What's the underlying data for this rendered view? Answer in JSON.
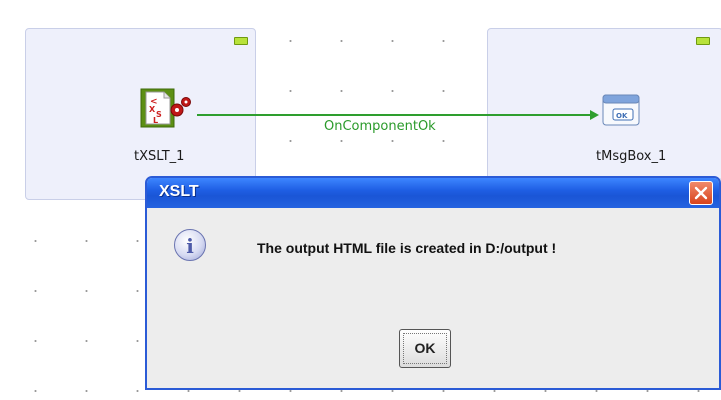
{
  "canvas": {
    "components": [
      {
        "label": "tXSLT_1",
        "icon": "xslt-icon"
      },
      {
        "label": "tMsgBox_1",
        "icon": "messagebox-icon"
      }
    ],
    "link": {
      "label": "OnComponentOk",
      "color": "#2e9e2e"
    }
  },
  "dialog": {
    "title": "XSLT",
    "message": "The output HTML file is created in D:/output !",
    "ok_label": "OK",
    "icons": {
      "info": "information-icon",
      "close": "close-icon"
    },
    "colors": {
      "titlebar": "#1f5fe4",
      "close": "#d8431c"
    }
  },
  "info_glyph": "i"
}
